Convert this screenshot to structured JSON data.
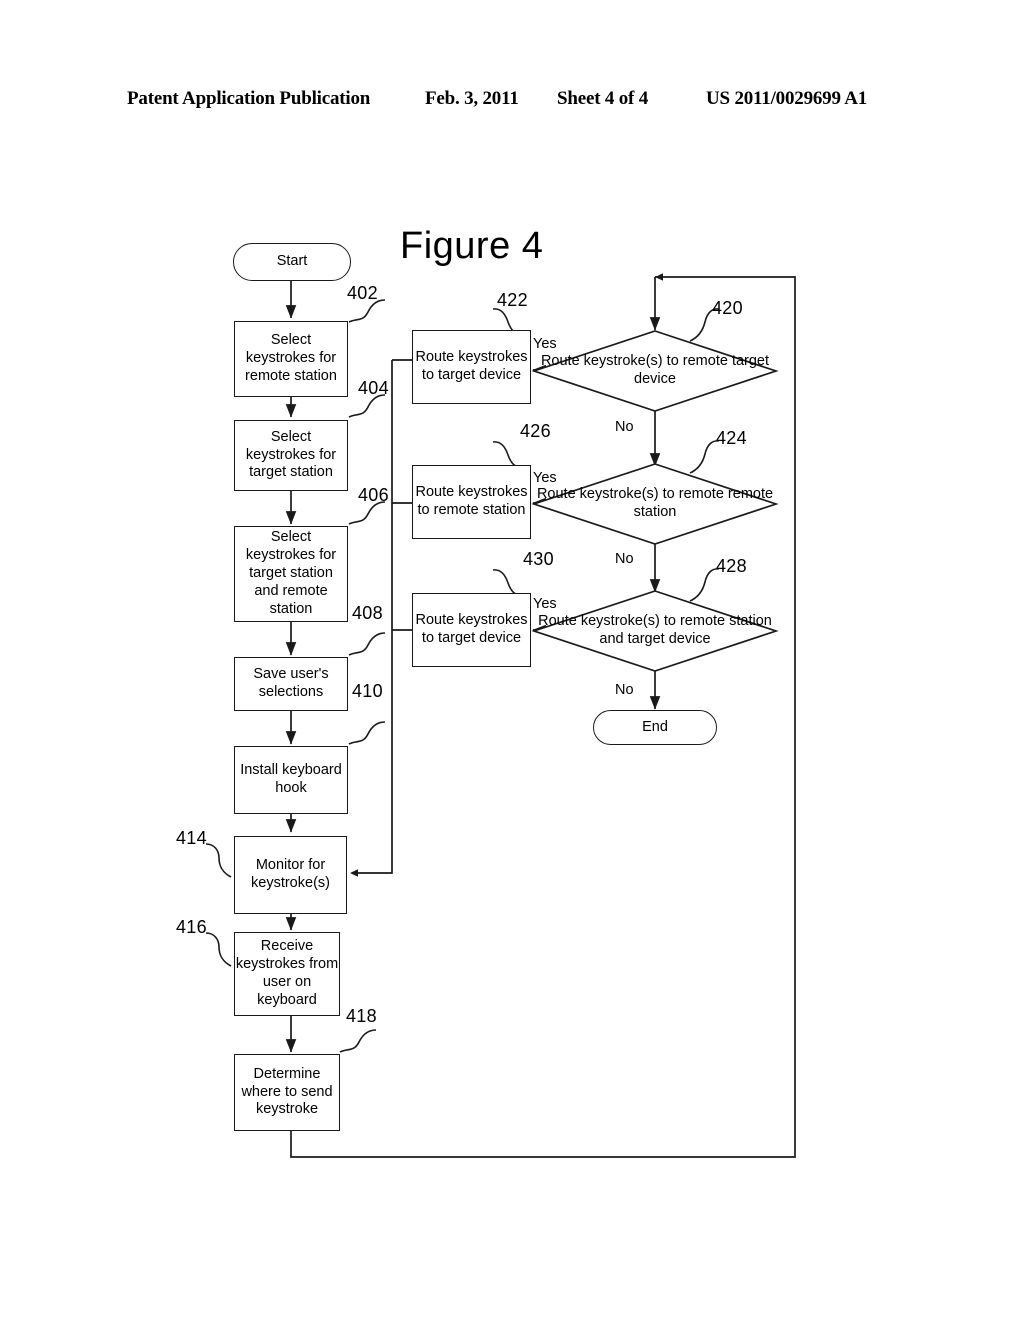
{
  "header": {
    "publication": "Patent Application Publication",
    "date": "Feb. 3, 2011",
    "sheet": "Sheet 4 of 4",
    "number": "US 2011/0029699 A1"
  },
  "figure": {
    "title": "Figure 4"
  },
  "nodes": {
    "start": {
      "label": "Start",
      "ref": ""
    },
    "n402": {
      "label": "Select keystrokes for remote station",
      "ref": "402"
    },
    "n404": {
      "label": "Select keystrokes for target station",
      "ref": "404"
    },
    "n406": {
      "label": "Select keystrokes for target station and remote station",
      "ref": "406"
    },
    "n408": {
      "label": "Save user's selections",
      "ref": "408"
    },
    "n410": {
      "label": "Install keyboard hook",
      "ref": "410"
    },
    "n414": {
      "label": "Monitor for keystroke(s)",
      "ref": "414"
    },
    "n416": {
      "label": "Receive keystrokes from user on keyboard",
      "ref": "416"
    },
    "n418": {
      "label": "Determine where to send keystroke",
      "ref": "418"
    },
    "n420": {
      "label": "Route keystroke(s) to remote target device",
      "ref": "420"
    },
    "n422": {
      "label": "Route keystrokes to target device",
      "ref": "422"
    },
    "n424": {
      "label": "Route keystroke(s) to remote remote station",
      "ref": "424"
    },
    "n426": {
      "label": "Route keystrokes to remote station",
      "ref": "426"
    },
    "n428": {
      "label": "Route keystroke(s) to remote station and target device",
      "ref": "428"
    },
    "n430": {
      "label": "Route keystrokes to target device",
      "ref": "430"
    },
    "end": {
      "label": "End",
      "ref": ""
    }
  },
  "edges": {
    "yes1": "Yes",
    "no1": "No",
    "yes2": "Yes",
    "no2": "No",
    "yes3": "Yes",
    "no3": "No"
  },
  "colors": {
    "line": "#1a1a1a",
    "text": "#000000",
    "background": "#ffffff"
  }
}
